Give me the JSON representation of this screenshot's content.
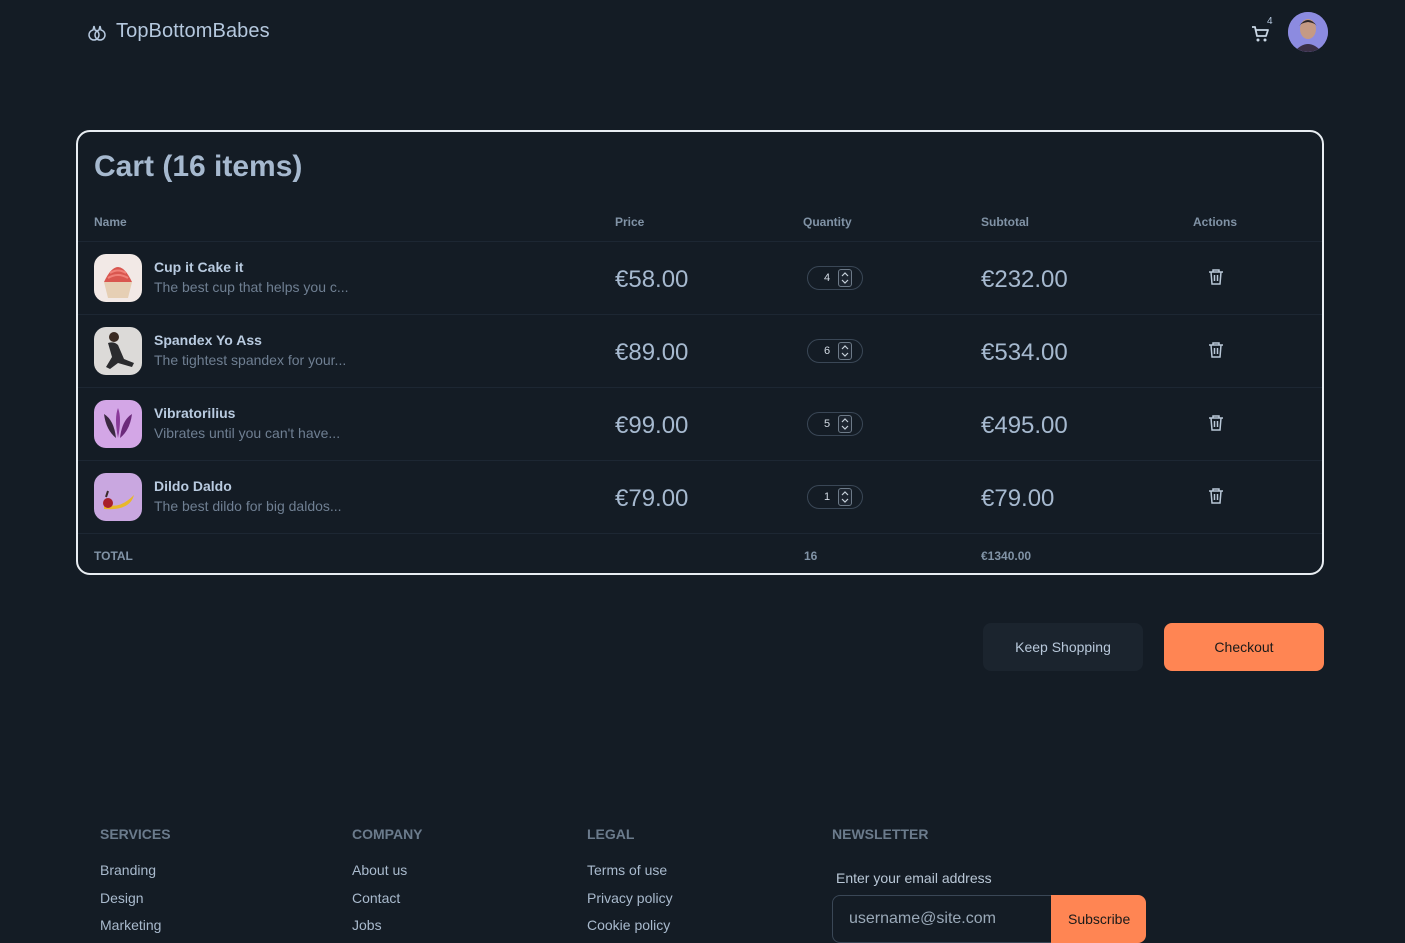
{
  "header": {
    "brand": "TopBottomBabes",
    "cart_count": "4"
  },
  "cart": {
    "title": "Cart (16 items)",
    "columns": {
      "name": "Name",
      "price": "Price",
      "quantity": "Quantity",
      "subtotal": "Subtotal",
      "actions": "Actions"
    },
    "items": [
      {
        "name": "Cup it Cake it",
        "description": "The best cup that helps you c...",
        "price": "€58.00",
        "quantity": "4",
        "subtotal": "€232.00"
      },
      {
        "name": "Spandex Yo Ass",
        "description": "The tightest spandex for your...",
        "price": "€89.00",
        "quantity": "6",
        "subtotal": "€534.00"
      },
      {
        "name": "Vibratorilius",
        "description": "Vibrates until you can't have...",
        "price": "€99.00",
        "quantity": "5",
        "subtotal": "€495.00"
      },
      {
        "name": "Dildo Daldo",
        "description": "The best dildo for big daldos...",
        "price": "€79.00",
        "quantity": "1",
        "subtotal": "€79.00"
      }
    ],
    "total_label": "TOTAL",
    "total_quantity": "16",
    "total_sum": "€1340.00"
  },
  "actions": {
    "keep_shopping": "Keep Shopping",
    "checkout": "Checkout"
  },
  "footer": {
    "services": {
      "title": "SERVICES",
      "links": [
        "Branding",
        "Design",
        "Marketing"
      ]
    },
    "company": {
      "title": "COMPANY",
      "links": [
        "About us",
        "Contact",
        "Jobs"
      ]
    },
    "legal": {
      "title": "LEGAL",
      "links": [
        "Terms of use",
        "Privacy policy",
        "Cookie policy"
      ]
    },
    "newsletter": {
      "title": "NEWSLETTER",
      "label": "Enter your email address",
      "placeholder": "username@site.com",
      "button": "Subscribe"
    }
  },
  "colors": {
    "background": "#141c25",
    "accent": "#ff8553",
    "text": "#a6b9cf"
  },
  "icons": [
    "logo-icon",
    "cart-icon",
    "trash-icon",
    "stepper-icon"
  ]
}
